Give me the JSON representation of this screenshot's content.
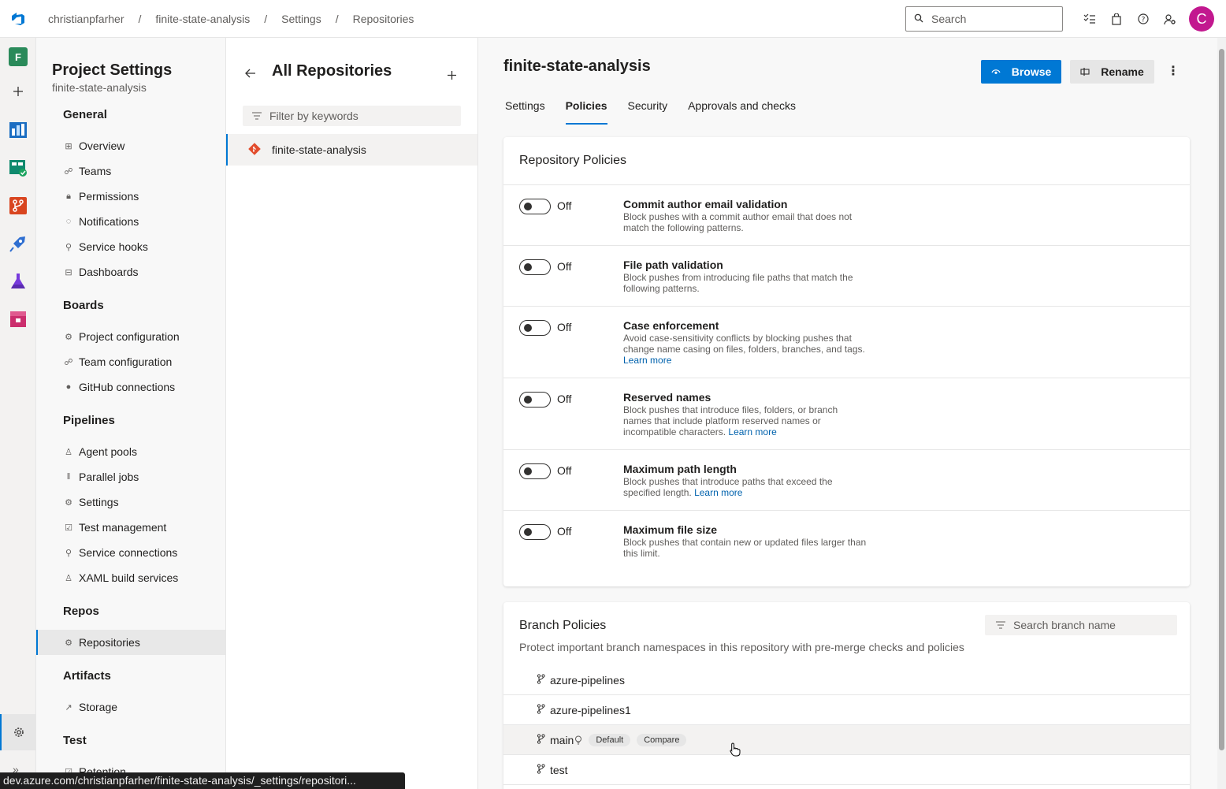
{
  "breadcrumbs": [
    "christianpfarher",
    "finite-state-analysis",
    "Settings",
    "Repositories"
  ],
  "top_search": {
    "placeholder": "Search"
  },
  "avatar_initial": "C",
  "rail": {
    "project_initial": "F"
  },
  "settings_nav": {
    "title": "Project Settings",
    "subtitle": "finite-state-analysis",
    "groups": [
      {
        "label": "General",
        "items": [
          "Overview",
          "Teams",
          "Permissions",
          "Notifications",
          "Service hooks",
          "Dashboards"
        ]
      },
      {
        "label": "Boards",
        "items": [
          "Project configuration",
          "Team configuration",
          "GitHub connections"
        ]
      },
      {
        "label": "Pipelines",
        "items": [
          "Agent pools",
          "Parallel jobs",
          "Settings",
          "Test management",
          "Service connections",
          "XAML build services"
        ]
      },
      {
        "label": "Repos",
        "items": [
          "Repositories"
        ]
      },
      {
        "label": "Artifacts",
        "items": [
          "Storage"
        ]
      },
      {
        "label": "Test",
        "items": [
          "Retention"
        ]
      }
    ]
  },
  "repos": {
    "title": "All Repositories",
    "filter_placeholder": "Filter by keywords",
    "items": [
      "finite-state-analysis"
    ]
  },
  "main": {
    "title": "finite-state-analysis",
    "browse_label": "Browse",
    "rename_label": "Rename",
    "tabs": [
      "Settings",
      "Policies",
      "Security",
      "Approvals and checks"
    ],
    "active_tab": "Policies"
  },
  "repository_policies": {
    "title": "Repository Policies",
    "toggle_state": "Off",
    "items": [
      {
        "title": "Commit author email validation",
        "desc": "Block pushes with a commit author email that does not match the following patterns.",
        "link": ""
      },
      {
        "title": "File path validation",
        "desc": "Block pushes from introducing file paths that match the following patterns.",
        "link": ""
      },
      {
        "title": "Case enforcement",
        "desc": "Avoid case-sensitivity conflicts by blocking pushes that change name casing on files, folders, branches, and tags.",
        "link": "Learn more"
      },
      {
        "title": "Reserved names",
        "desc": "Block pushes that introduce files, folders, or branch names that include platform reserved names or incompatible characters.",
        "link": "Learn more"
      },
      {
        "title": "Maximum path length",
        "desc": "Block pushes that introduce paths that exceed the specified length.",
        "link": "Learn more"
      },
      {
        "title": "Maximum file size",
        "desc": "Block pushes that contain new or updated files larger than this limit.",
        "link": ""
      }
    ]
  },
  "branch_policies": {
    "title": "Branch Policies",
    "search_placeholder": "Search branch name",
    "description": "Protect important branch namespaces in this repository with pre-merge checks and policies",
    "branches": [
      {
        "name": "azure-pipelines",
        "badges": []
      },
      {
        "name": "azure-pipelines1",
        "badges": []
      },
      {
        "name": "main",
        "badges": [
          "Default",
          "Compare"
        ]
      },
      {
        "name": "test",
        "badges": []
      }
    ]
  },
  "status_url": "dev.azure.com/christianpfarher/finite-state-analysis/_settings/repositori..."
}
